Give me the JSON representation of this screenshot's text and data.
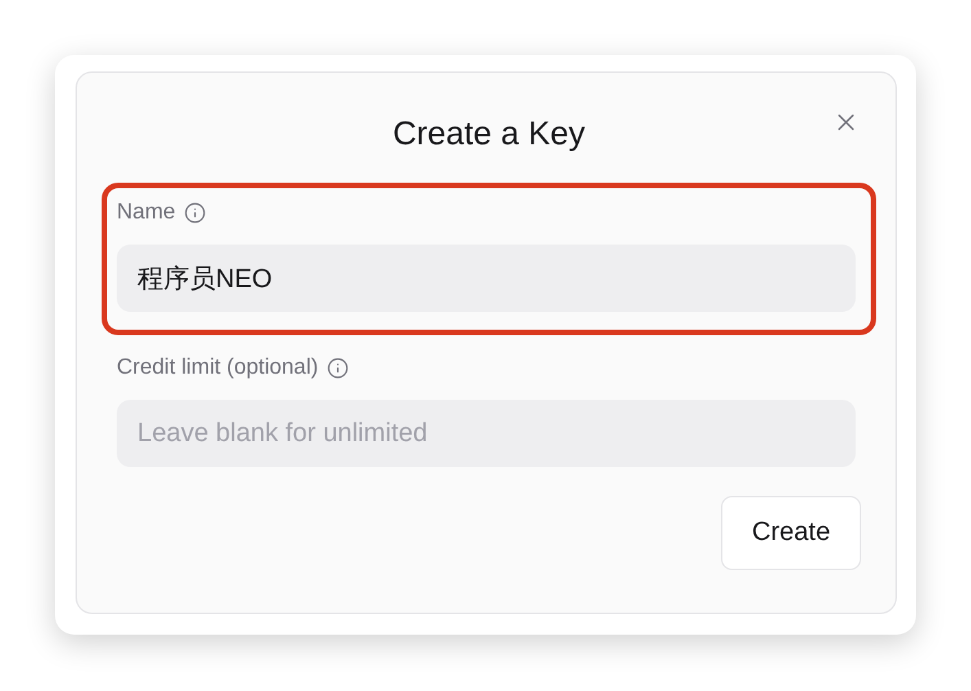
{
  "dialog": {
    "title": "Create a Key",
    "fields": [
      {
        "label": "Name",
        "value": "程序员NEO",
        "highlighted": true
      },
      {
        "label": "Credit limit (optional)",
        "placeholder": "Leave blank for unlimited",
        "highlighted": false
      }
    ],
    "buttons": [
      "Create"
    ]
  }
}
